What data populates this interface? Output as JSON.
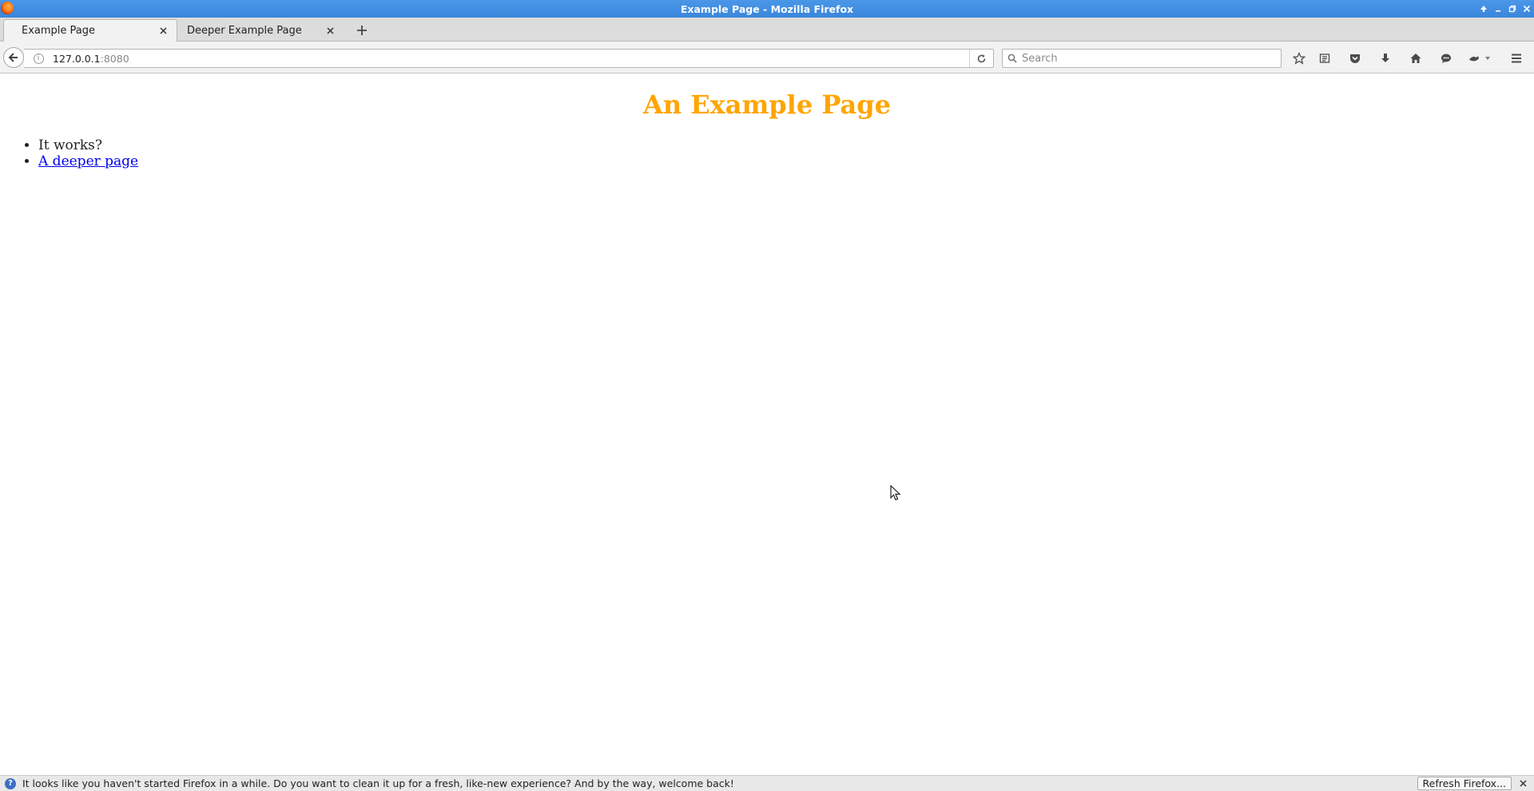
{
  "window": {
    "title": "Example Page - Mozilla Firefox"
  },
  "tabs": [
    {
      "label": "Example Page",
      "active": true
    },
    {
      "label": "Deeper Example Page",
      "active": false
    }
  ],
  "urlbar": {
    "host": "127.0.0.1",
    "port": ":8080"
  },
  "searchbar": {
    "placeholder": "Search"
  },
  "toolbar_icons": [
    "bookmark-star-icon",
    "reading-list-icon",
    "pocket-icon",
    "downloads-icon",
    "home-icon",
    "chat-icon",
    "extension-icon",
    "menu-icon"
  ],
  "page": {
    "heading": "An Example Page",
    "heading_color": "#ffa500",
    "items": [
      {
        "text": "It works?",
        "is_link": false
      },
      {
        "text": "A deeper page",
        "is_link": true
      }
    ]
  },
  "notification": {
    "message": "It looks like you haven't started Firefox in a while. Do you want to clean it up for a fresh, like-new experience? And by the way, welcome back!",
    "button_label": "Refresh Firefox..."
  }
}
